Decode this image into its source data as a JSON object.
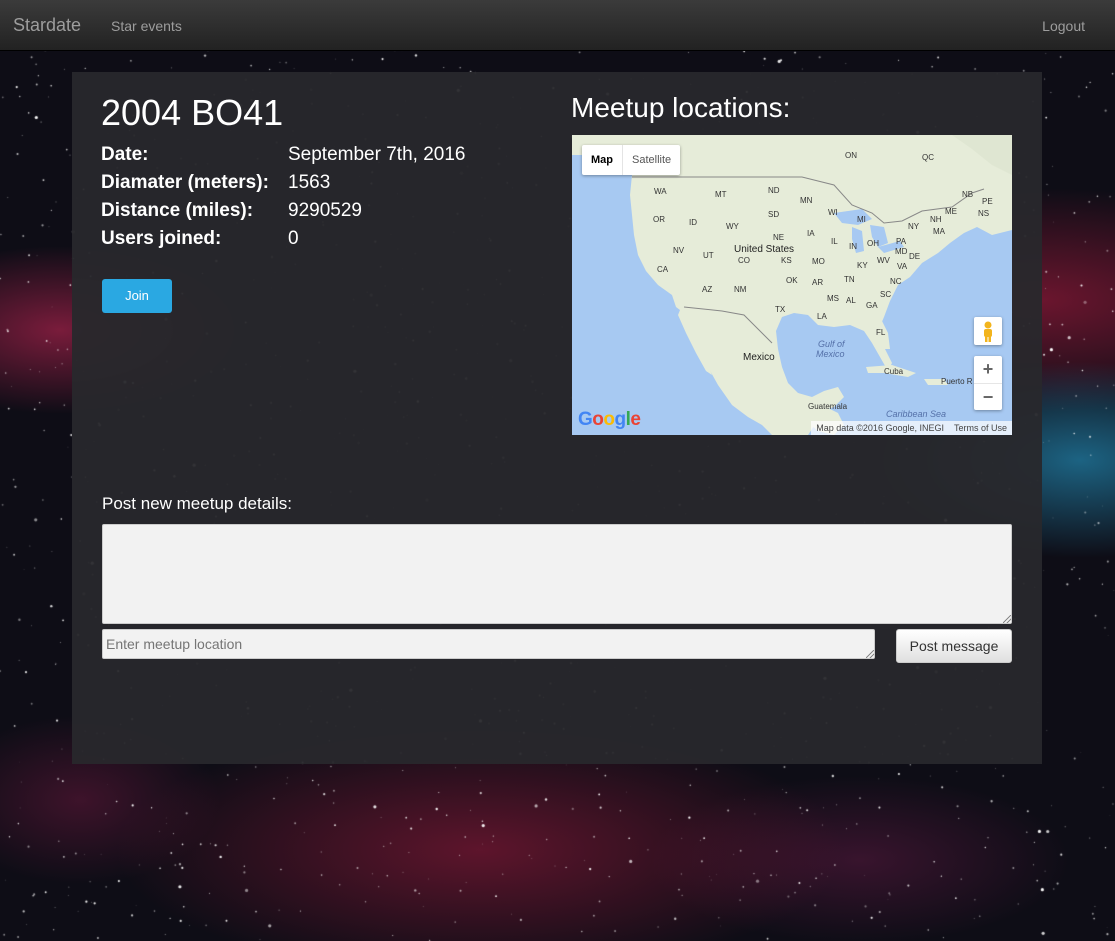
{
  "navbar": {
    "brand": "Stardate",
    "links": [
      {
        "label": "Star events"
      }
    ],
    "logout_label": "Logout"
  },
  "asteroid": {
    "name": "2004 BO41",
    "details": [
      {
        "label": "Date:",
        "value": "September 7th, 2016"
      },
      {
        "label": "Diamater (meters):",
        "value": "1563"
      },
      {
        "label": "Distance (miles):",
        "value": "9290529"
      },
      {
        "label": "Users joined:",
        "value": "0"
      }
    ],
    "join_label": "Join"
  },
  "map": {
    "title": "Meetup locations:",
    "type_buttons": [
      "Map",
      "Satellite"
    ],
    "zoom_in": "+",
    "zoom_out": "−",
    "logo": "Google",
    "attribution": "Map data ©2016 Google, INEGI",
    "terms": "Terms of Use",
    "labels": {
      "on": "ON",
      "qc": "QC",
      "nb": "NB",
      "pe": "PE",
      "ns": "NS",
      "me": "ME",
      "wa": "WA",
      "mt": "MT",
      "nd": "ND",
      "mn": "MN",
      "or": "OR",
      "id": "ID",
      "sd": "SD",
      "wi": "WI",
      "mi": "MI",
      "wy": "WY",
      "ny": "NY",
      "nh": "NH",
      "ma": "MA",
      "ne": "NE",
      "ia": "IA",
      "nv": "NV",
      "ut": "UT",
      "us": "United States",
      "co": "CO",
      "ks": "KS",
      "mo": "MO",
      "il": "IL",
      "in": "IN",
      "oh": "OH",
      "pa": "PA",
      "md": "MD",
      "de": "DE",
      "wv": "WV",
      "va": "VA",
      "ky": "KY",
      "ca": "CA",
      "az": "AZ",
      "nm": "NM",
      "ok": "OK",
      "ar": "AR",
      "tn": "TN",
      "nc": "NC",
      "sc": "SC",
      "ms": "MS",
      "al": "AL",
      "ga": "GA",
      "tx": "TX",
      "la": "LA",
      "fl": "FL",
      "mexico": "Mexico",
      "gulf": "Gulf of",
      "gulf2": "Mexico",
      "cuba": "Cuba",
      "pr": "Puerto R",
      "guatemala": "Guatemala",
      "caribbean": "Caribbean Sea"
    }
  },
  "post": {
    "label": "Post new meetup details:",
    "details_value": "",
    "location_placeholder": "Enter meetup location",
    "location_value": "",
    "button_label": "Post message"
  },
  "colors": {
    "join_button": "#2aa8e2",
    "panel": "#28282c",
    "map_water": "#a7c9f2",
    "map_land": "#e6ecd9"
  }
}
